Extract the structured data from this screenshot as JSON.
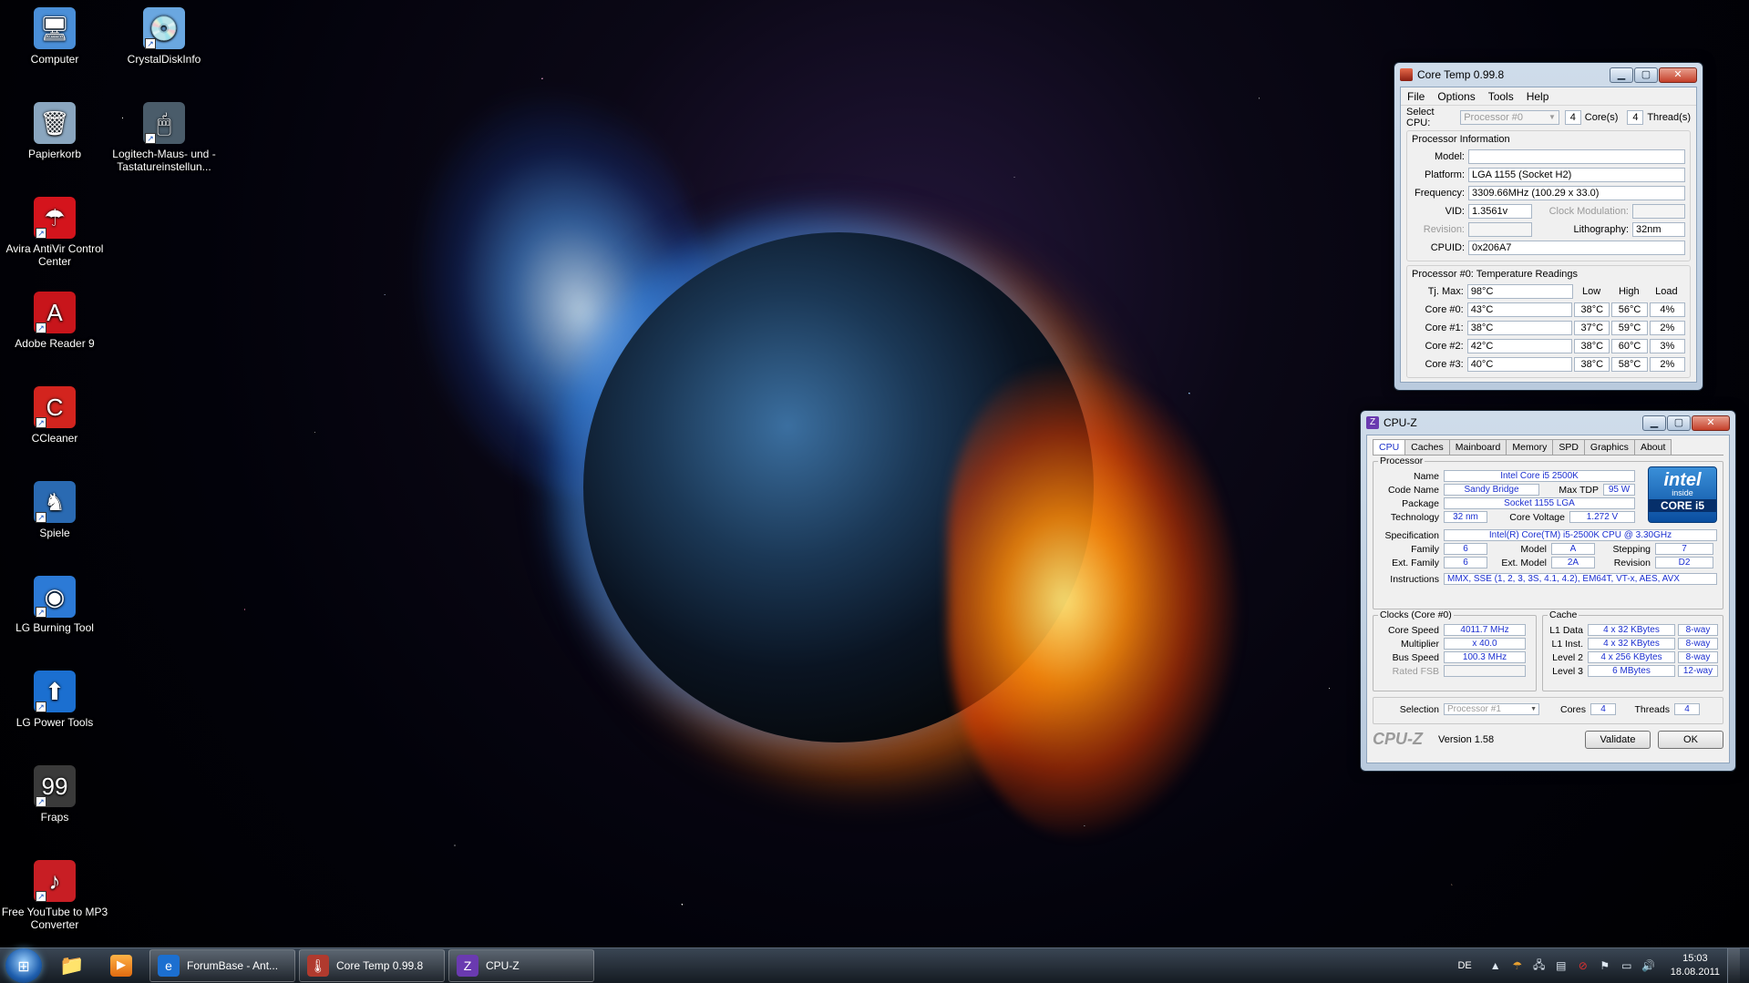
{
  "desktop": {
    "icons": [
      {
        "label": "Computer",
        "icon": "computer-icon",
        "color": "#4a8fd8",
        "glyph": "🖥"
      },
      {
        "label": "CrystalDiskInfo",
        "icon": "crystaldiskinfo-icon",
        "color": "#6aa7e0",
        "glyph": "💿"
      },
      {
        "label": "Papierkorb",
        "icon": "recycle-bin-icon",
        "color": "#8aa6bf",
        "glyph": "🗑"
      },
      {
        "label": "Logitech-Maus- und -Tastatureinstellun...",
        "icon": "logitech-mouse-icon",
        "color": "#4a5c6a",
        "glyph": "🖱"
      },
      {
        "label": "Avira AntiVir Control Center",
        "icon": "avira-icon",
        "color": "#d4141c",
        "glyph": "☂"
      },
      {
        "label": "Adobe Reader 9",
        "icon": "adobe-reader-icon",
        "color": "#c8151b",
        "glyph": "A"
      },
      {
        "label": "CCleaner",
        "icon": "ccleaner-icon",
        "color": "#d3241e",
        "glyph": "C"
      },
      {
        "label": "Spiele",
        "icon": "games-icon",
        "color": "#2a6ab2",
        "glyph": "♞"
      },
      {
        "label": "LG Burning Tool",
        "icon": "lg-burning-tool-icon",
        "color": "#2c7ad6",
        "glyph": "◉"
      },
      {
        "label": "LG Power Tools",
        "icon": "lg-power-tools-icon",
        "color": "#1b6fd0",
        "glyph": "⬆"
      },
      {
        "label": "Fraps",
        "icon": "fraps-icon",
        "color": "#3a3a3a",
        "glyph": "99"
      },
      {
        "label": "Free YouTube to MP3 Converter",
        "icon": "youtube-mp3-icon",
        "color": "#c81e24",
        "glyph": "♪"
      }
    ]
  },
  "coretemp": {
    "title": "Core Temp 0.99.8",
    "menu": [
      "File",
      "Options",
      "Tools",
      "Help"
    ],
    "select_cpu_label": "Select CPU:",
    "select_cpu_value": "Processor #0",
    "cores_count": "4",
    "cores_label": "Core(s)",
    "threads_count": "4",
    "threads_label": "Thread(s)",
    "proc_info_title": "Processor Information",
    "model_label": "Model:",
    "model_value": "",
    "platform_label": "Platform:",
    "platform_value": "LGA 1155 (Socket H2)",
    "frequency_label": "Frequency:",
    "frequency_value": "3309.66MHz (100.29 x 33.0)",
    "vid_label": "VID:",
    "vid_value": "1.3561v",
    "clock_mod_label": "Clock Modulation:",
    "clock_mod_value": "",
    "revision_label": "Revision:",
    "revision_value": "",
    "lithography_label": "Lithography:",
    "lithography_value": "32nm",
    "cpuid_label": "CPUID:",
    "cpuid_value": "0x206A7",
    "temps_title": "Processor #0: Temperature Readings",
    "col_low": "Low",
    "col_high": "High",
    "col_load": "Load",
    "tjmax_label": "Tj. Max:",
    "tjmax_value": "98°C",
    "cores": [
      {
        "label": "Core #0:",
        "temp": "43°C",
        "low": "38°C",
        "high": "56°C",
        "load": "4%"
      },
      {
        "label": "Core #1:",
        "temp": "38°C",
        "low": "37°C",
        "high": "59°C",
        "load": "2%"
      },
      {
        "label": "Core #2:",
        "temp": "42°C",
        "low": "38°C",
        "high": "60°C",
        "load": "3%"
      },
      {
        "label": "Core #3:",
        "temp": "40°C",
        "low": "38°C",
        "high": "58°C",
        "load": "2%"
      }
    ]
  },
  "cpuz": {
    "title": "CPU-Z",
    "tabs": [
      "CPU",
      "Caches",
      "Mainboard",
      "Memory",
      "SPD",
      "Graphics",
      "About"
    ],
    "processor_group": "Processor",
    "name_label": "Name",
    "name_value": "Intel Core i5 2500K",
    "codename_label": "Code Name",
    "codename_value": "Sandy Bridge",
    "maxtdp_label": "Max TDP",
    "maxtdp_value": "95 W",
    "package_label": "Package",
    "package_value": "Socket 1155 LGA",
    "technology_label": "Technology",
    "technology_value": "32 nm",
    "corevoltage_label": "Core Voltage",
    "corevoltage_value": "1.272 V",
    "spec_label": "Specification",
    "spec_value": "Intel(R) Core(TM) i5-2500K CPU @ 3.30GHz",
    "family_label": "Family",
    "family_value": "6",
    "model_label": "Model",
    "model_value": "A",
    "stepping_label": "Stepping",
    "stepping_value": "7",
    "extfamily_label": "Ext. Family",
    "extfamily_value": "6",
    "extmodel_label": "Ext. Model",
    "extmodel_value": "2A",
    "revision_label": "Revision",
    "revision_value": "D2",
    "instructions_label": "Instructions",
    "instructions_value": "MMX, SSE (1, 2, 3, 3S, 4.1, 4.2), EM64T, VT-x, AES, AVX",
    "intel_logo_text": "intel",
    "intel_logo_sub": "inside",
    "intel_logo_core": "CORE i5",
    "clocks_group": "Clocks (Core #0)",
    "corespeed_label": "Core Speed",
    "corespeed_value": "4011.7 MHz",
    "multiplier_label": "Multiplier",
    "multiplier_value": "x 40.0",
    "busspeed_label": "Bus Speed",
    "busspeed_value": "100.3 MHz",
    "ratedfsb_label": "Rated FSB",
    "ratedfsb_value": "",
    "cache_group": "Cache",
    "cache": [
      {
        "label": "L1 Data",
        "size": "4 x 32 KBytes",
        "way": "8-way"
      },
      {
        "label": "L1 Inst.",
        "size": "4 x 32 KBytes",
        "way": "8-way"
      },
      {
        "label": "Level 2",
        "size": "4 x 256 KBytes",
        "way": "8-way"
      },
      {
        "label": "Level 3",
        "size": "6 MBytes",
        "way": "12-way"
      }
    ],
    "selection_label": "Selection",
    "selection_value": "Processor #1",
    "cores_label": "Cores",
    "cores_value": "4",
    "threads_label": "Threads",
    "threads_value": "4",
    "brand": "CPU-Z",
    "version": "Version 1.58",
    "validate_label": "Validate",
    "ok_label": "OK"
  },
  "taskbar": {
    "items": [
      {
        "label": "ForumBase - Ant...",
        "icon": "internet-explorer-icon",
        "color": "#1c6fd0",
        "glyph": "e"
      },
      {
        "label": "Core Temp 0.99.8",
        "icon": "coretemp-icon",
        "color": "#b03a2e",
        "glyph": "🌡"
      },
      {
        "label": "CPU-Z",
        "icon": "cpuz-icon",
        "color": "#6a3ab0",
        "glyph": "Z"
      }
    ],
    "language": "DE",
    "time": "15:03",
    "date": "18.08.2011"
  },
  "colors": {
    "cpuz_value": "#1a2fd0",
    "intel_blue": "#0a4ea0",
    "titlebar": "#cfdcea",
    "close_red": "#c5402a"
  }
}
